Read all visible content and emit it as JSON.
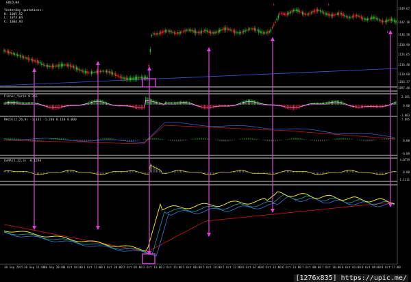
{
  "window": {
    "symbol_title": "GOLD,H4"
  },
  "quotations": {
    "header": "Yesterday quotations:",
    "high": "H: 1085.52",
    "low": "L: 1074.04",
    "close": "C: 1084.93"
  },
  "indicators": {
    "fisher": "Fisher_Yurik 0.355",
    "macd": "MACD(12,26,9) -1.131 -1.240 0.110 0.000",
    "osma": "OsMA(5,12,3) -0.1294"
  },
  "price_scale": [
    "1149.67",
    "1142.10",
    "1136.50",
    "1130.90",
    "1124.65",
    "1116.40",
    "1110.60",
    "1103.37",
    "1097.40"
  ],
  "fisher_scale": [
    "2.381",
    "0.00",
    "-1.003"
  ],
  "macd_scale": [
    "7.095",
    "0.00",
    "-6.09"
  ],
  "osma_scale": [
    "4.0739",
    "0.00",
    "-1.1111"
  ],
  "time_axis": [
    "30 Sep 2015",
    "30 Sep 11:00",
    "30 Sep 20:00",
    "1 Oct 04:00",
    "1 Oct 12:00",
    "1 Oct 20:00",
    "2 Oct 05:00",
    "2 Oct 13:00",
    "2 Oct 21:00",
    "5 Oct 06:00",
    "5 Oct 14:00",
    "5 Oct 22:00",
    "6 Oct 07:00",
    "6 Oct 15:00",
    "6 Oct 23:00",
    "7 Oct 08:00",
    "7 Oct 16:00",
    "8 Oct 01:00",
    "8 Oct 09:00",
    "8 Oct 17:00"
  ],
  "watermark": "[1276x835] https://upic.me/",
  "colors": {
    "candles": "#1fd11f",
    "candles_down": "#ff3030",
    "trendline": "#3a5bd9",
    "arrows": "#e040e0",
    "highlight": "#d33ed3",
    "ema_yellow": "#e8e820",
    "ema_red": "#d01818",
    "ema_blue": "#3a7ae0"
  }
}
